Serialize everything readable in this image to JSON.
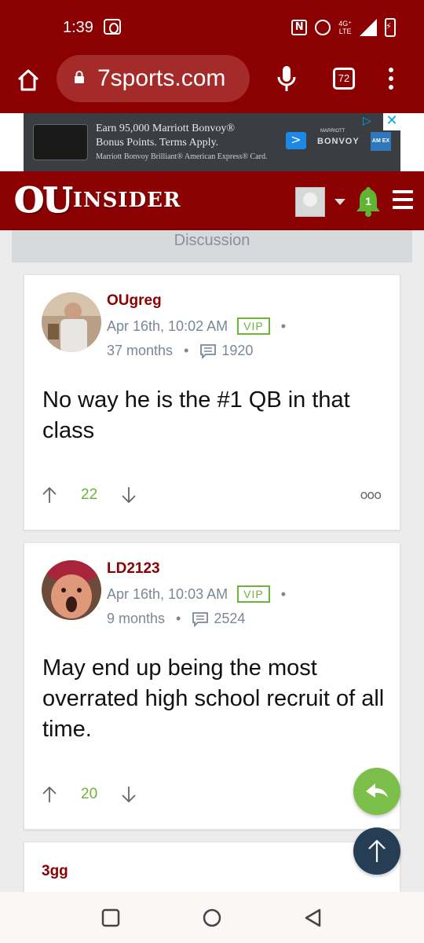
{
  "status_bar": {
    "time": "1:39",
    "network_label_top": "4G⁺",
    "network_label_bottom": "LTE"
  },
  "browser": {
    "url": "7sports.com",
    "tab_count": "72"
  },
  "ad": {
    "line1": "Earn 95,000 Marriott Bonvoy®",
    "line2": "Bonus Points. Terms Apply.",
    "line3": "Marriott Bonvoy Brilliant® American Express® Card.",
    "brand_small": "MARRIOTT",
    "brand": "BONVOY",
    "amex_label": "AM EX"
  },
  "site_header": {
    "logo_ou": "OU",
    "logo_insider": "INSIDER",
    "notification_count": "1"
  },
  "section": {
    "title": "Discussion"
  },
  "posts": [
    {
      "username": "OUgreg",
      "date": "Apr 16th, 10:02 AM",
      "badge": "VIP",
      "tenure": "37 months",
      "post_count": "1920",
      "body": "No way he is the #1 QB in that class",
      "votes": "22"
    },
    {
      "username": "LD2123",
      "date": "Apr 16th, 10:03 AM",
      "badge": "VIP",
      "tenure": "9 months",
      "post_count": "2524",
      "body": "May end up being the most overrated high school recruit of all time.",
      "votes": "20"
    },
    {
      "username": "3gg"
    }
  ],
  "icons": {
    "home": "home-icon",
    "lock": "lock-icon",
    "mic": "mic-icon",
    "menu": "menu-dots-icon",
    "bell": "bell-icon",
    "hamburger": "hamburger-icon",
    "upvote": "arrow-up-icon",
    "downvote": "arrow-down-icon",
    "comment": "comment-icon",
    "reply": "reply-icon",
    "scroll_top": "arrow-up-icon"
  },
  "colors": {
    "brand": "#8b0000",
    "accent_green": "#6ab53a",
    "meta_gray": "#7a8896",
    "fab_dark": "#253e55"
  }
}
